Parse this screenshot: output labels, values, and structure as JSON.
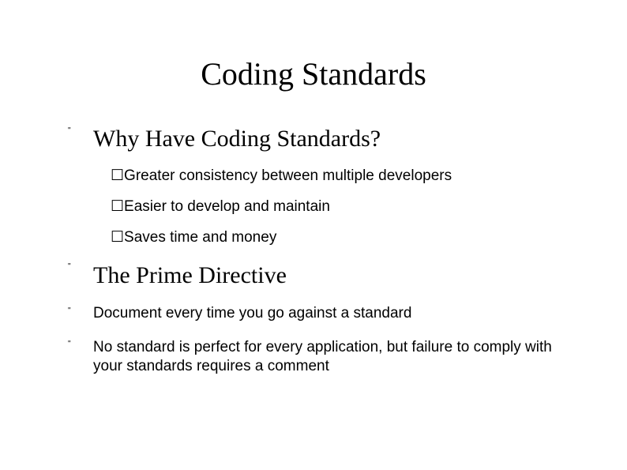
{
  "title": "Coding Standards",
  "items": [
    {
      "text": "Why Have Coding Standards?",
      "level": "h1",
      "sub": [
        "Greater consistency between multiple developers",
        "Easier to develop and maintain",
        "Saves time and money"
      ]
    },
    {
      "text": "The Prime Directive",
      "level": "h1",
      "sub": []
    },
    {
      "text": "Document every time you go against a standard",
      "level": "body",
      "sub": []
    },
    {
      "text": "No standard is perfect for every application, but failure to comply with your standards requires a comment",
      "level": "body",
      "sub": []
    }
  ],
  "bullet_marks": {
    "outer": "\"",
    "inner": "☐"
  }
}
